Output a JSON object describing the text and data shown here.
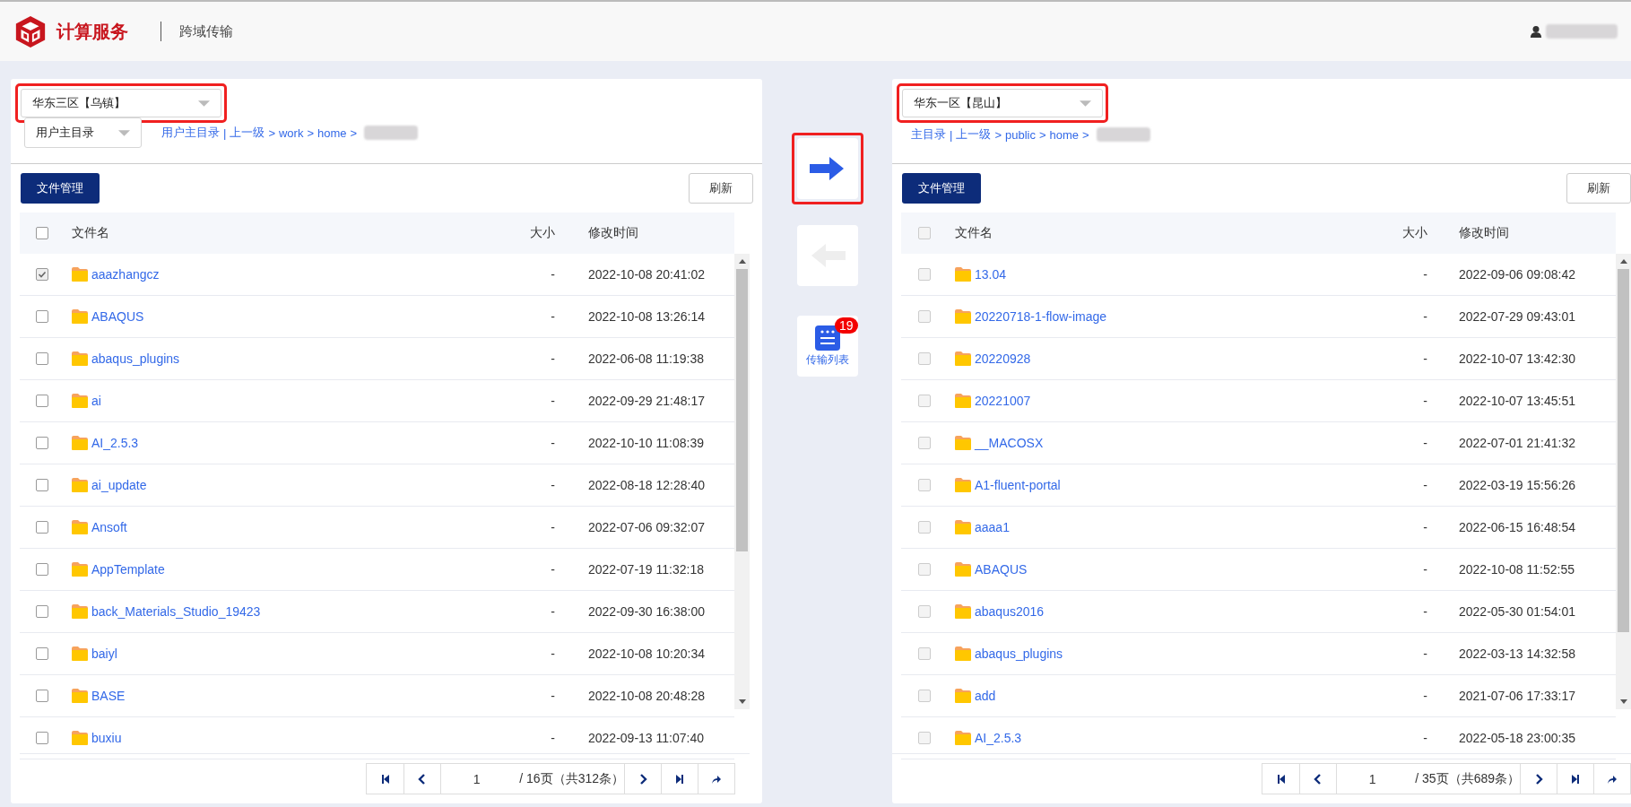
{
  "header": {
    "logo_text": "计算服务",
    "section": "跨域传输"
  },
  "panels": [
    {
      "region": "华东三区【乌镇】",
      "region_highlighted": true,
      "home_select": "用户主目录",
      "breadcrumb": {
        "links": [
          "用户主目录",
          "上一级",
          "work",
          "home"
        ],
        "separators": [
          "|",
          ">",
          ">",
          ">"
        ]
      },
      "header_checked": false,
      "file_button": "文件管理",
      "refresh_button": "刷新",
      "checkboxes_disabled": false,
      "columns": [
        "文件名",
        "大小",
        "修改时间"
      ],
      "rows": [
        {
          "name": "aaazhangcz",
          "size": "-",
          "time": "2022-10-08 20:41:02",
          "checked": true
        },
        {
          "name": "ABAQUS",
          "size": "-",
          "time": "2022-10-08 13:26:14",
          "checked": false
        },
        {
          "name": "abaqus_plugins",
          "size": "-",
          "time": "2022-06-08 11:19:38",
          "checked": false
        },
        {
          "name": "ai",
          "size": "-",
          "time": "2022-09-29 21:48:17",
          "checked": false
        },
        {
          "name": "AI_2.5.3",
          "size": "-",
          "time": "2022-10-10 11:08:39",
          "checked": false
        },
        {
          "name": "ai_update",
          "size": "-",
          "time": "2022-08-18 12:28:40",
          "checked": false
        },
        {
          "name": "Ansoft",
          "size": "-",
          "time": "2022-07-06 09:32:07",
          "checked": false
        },
        {
          "name": "AppTemplate",
          "size": "-",
          "time": "2022-07-19 11:32:18",
          "checked": false
        },
        {
          "name": "back_Materials_Studio_19423",
          "size": "-",
          "time": "2022-09-30 16:38:00",
          "checked": false
        },
        {
          "name": "baiyl",
          "size": "-",
          "time": "2022-10-08 10:20:34",
          "checked": false
        },
        {
          "name": "BASE",
          "size": "-",
          "time": "2022-10-08 20:48:28",
          "checked": false
        },
        {
          "name": "buxiu",
          "size": "-",
          "time": "2022-09-13 11:07:40",
          "checked": false
        }
      ],
      "pagination": {
        "page": "1",
        "summary": "/ 16页（共312条）"
      }
    },
    {
      "region": "华东一区【昆山】",
      "region_highlighted": true,
      "breadcrumb": {
        "links": [
          "主目录",
          "上一级",
          "public",
          "home"
        ],
        "separators": [
          "|",
          ">",
          ">",
          ">"
        ]
      },
      "header_checked": false,
      "file_button": "文件管理",
      "refresh_button": "刷新",
      "checkboxes_disabled": true,
      "columns": [
        "文件名",
        "大小",
        "修改时间"
      ],
      "rows": [
        {
          "name": "13.04",
          "size": "-",
          "time": "2022-09-06 09:08:42",
          "checked": false
        },
        {
          "name": "20220718-1-flow-image",
          "size": "-",
          "time": "2022-07-29 09:43:01",
          "checked": false
        },
        {
          "name": "20220928",
          "size": "-",
          "time": "2022-10-07 13:42:30",
          "checked": false
        },
        {
          "name": "20221007",
          "size": "-",
          "time": "2022-10-07 13:45:51",
          "checked": false
        },
        {
          "name": "__MACOSX",
          "size": "-",
          "time": "2022-07-01 21:41:32",
          "checked": false
        },
        {
          "name": "A1-fluent-portal",
          "size": "-",
          "time": "2022-03-19 15:56:26",
          "checked": false
        },
        {
          "name": "aaaa1",
          "size": "-",
          "time": "2022-06-15 16:48:54",
          "checked": false
        },
        {
          "name": "ABAQUS",
          "size": "-",
          "time": "2022-10-08 11:52:55",
          "checked": false
        },
        {
          "name": "abaqus2016",
          "size": "-",
          "time": "2022-05-30 01:54:01",
          "checked": false
        },
        {
          "name": "abaqus_plugins",
          "size": "-",
          "time": "2022-03-13 14:32:58",
          "checked": false
        },
        {
          "name": "add",
          "size": "-",
          "time": "2021-07-06 17:33:17",
          "checked": false
        },
        {
          "name": "AI_2.5.3",
          "size": "-",
          "time": "2022-05-18 23:00:35",
          "checked": false
        }
      ],
      "pagination": {
        "page": "1",
        "summary": "/ 35页（共689条）"
      }
    }
  ],
  "transfer": {
    "right_highlighted": true,
    "left_disabled": true,
    "list_label": "传输列表",
    "badge": "19"
  }
}
